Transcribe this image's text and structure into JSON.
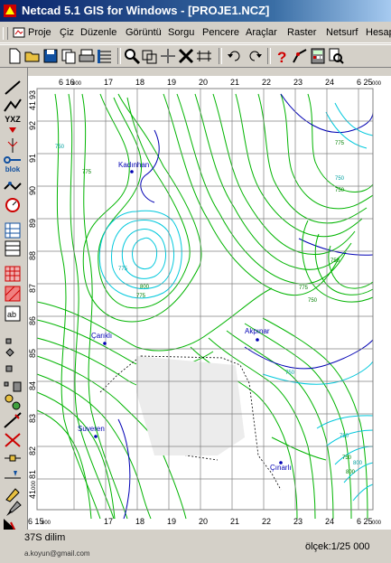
{
  "window": {
    "title": "Netcad 5.1 GIS for Windows - [PROJE1.NCZ]"
  },
  "menu": [
    "Proje",
    "Çiz",
    "Düzenle",
    "Görüntü",
    "Sorgu",
    "Pencere",
    "Araçlar",
    "Raster",
    "Netsurf",
    "Hesap"
  ],
  "toolbar": [
    "new-icon",
    "open-icon",
    "save-icon",
    "copy-icon",
    "print-icon",
    "list-icon",
    "zoom-icon",
    "window-icon",
    "pan-icon",
    "cross-tool-icon",
    "measure-icon",
    "undo-icon",
    "redo-icon",
    "help-icon",
    "line-tool-icon",
    "calculator-icon",
    "find-icon"
  ],
  "left_tools": {
    "xyz": "YXZ",
    "blok": "blok",
    "ab": "ab"
  },
  "map": {
    "top_labels": [
      "6 16",
      "000",
      "17",
      "18",
      "19",
      "20",
      "21",
      "22",
      "23",
      "24",
      "6 25",
      "000"
    ],
    "bottom_labels": [
      "6 15",
      "000",
      "17",
      "18",
      "19",
      "20",
      "21",
      "22",
      "23",
      "24",
      "6 25",
      "000"
    ],
    "side_labels": [
      "93",
      "41",
      "92",
      "91",
      "90",
      "89",
      "88",
      "87",
      "86",
      "85",
      "84",
      "83",
      "82",
      "81",
      "000",
      "41"
    ],
    "places": [
      "Kadınhan",
      "Çarıklı",
      "Akpınar",
      "Suveren",
      "Çınarlı"
    ],
    "contour_labels": [
      "750",
      "775",
      "775",
      "750",
      "750",
      "750",
      "775",
      "775",
      "800",
      "750",
      "775",
      "750",
      "750",
      "750",
      "800",
      "800"
    ],
    "colors": {
      "contour_main": "#00b400",
      "contour_cyan": "#00c8dc",
      "contour_blue": "#0000b4",
      "grid": "#808080"
    }
  },
  "status": {
    "zone": "37S dilim",
    "scale": "ölçek:1/25 000",
    "email": "a.koyun@gmail.com"
  }
}
